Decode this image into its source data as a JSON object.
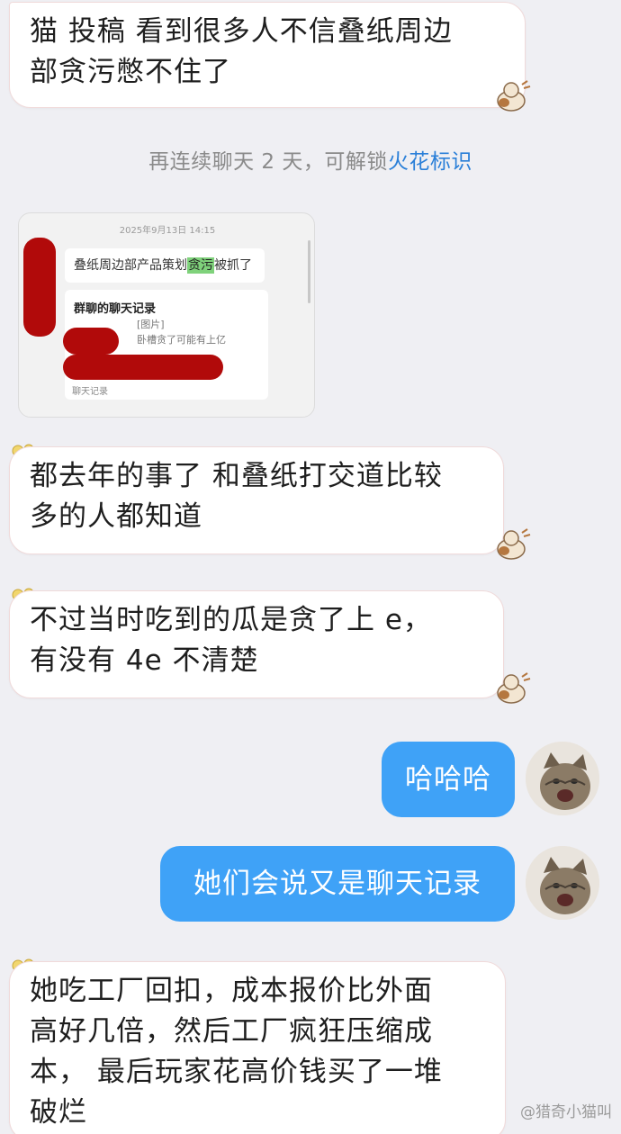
{
  "messages": [
    {
      "text": "猫 投稿 看到很多人不信叠纸周边\n部贪污憋不住了"
    },
    {
      "text": "都去年的事了 和叠纸打交道比较\n多的人都知道"
    },
    {
      "text": "不过当时吃到的瓜是贪了上 e，\n有没有 4e 不清楚"
    },
    {
      "text": "哈哈哈"
    },
    {
      "text": "她们会说又是聊天记录"
    },
    {
      "text": "她吃工厂回扣，成本报价比外面\n高好几倍，然后工厂疯狂压缩成\n本， 最后玩家花高价钱买了一堆\n破烂"
    }
  ],
  "system_notice": {
    "prefix": "再连续聊天 2 天，可解锁",
    "link": "火花标识"
  },
  "screenshot_card": {
    "timestamp": "2025年9月13日 14:15",
    "message_before": "叠纸周边部产品策划",
    "message_highlight": "贪污",
    "message_after": "被抓了",
    "record_title": "群聊的聊天记录",
    "record_line1": "[图片]",
    "record_line2": "卧槽贪了可能有上亿",
    "record_footer": "聊天记录"
  },
  "watermark": "@猎奇小猫叫"
}
